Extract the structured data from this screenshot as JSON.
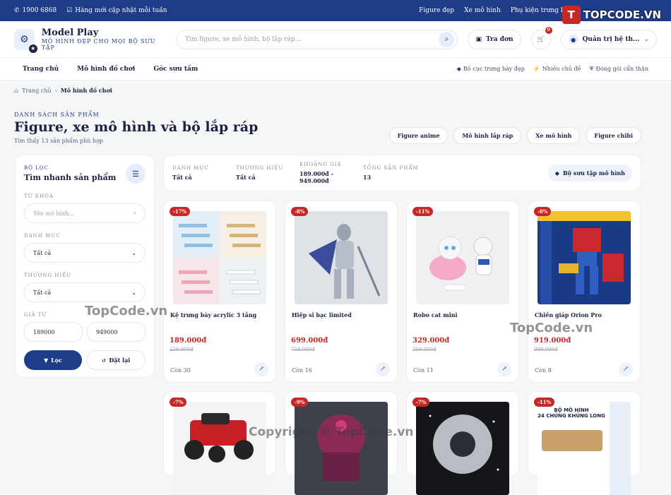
{
  "topbar": {
    "phone": "1900 6868",
    "notice": "Hàng mới cập nhật mỗi tuần",
    "links": [
      "Figure đẹp",
      "Xe mô hình",
      "Phụ kiện trưng bày"
    ]
  },
  "badge": {
    "mark": "T",
    "text": "TOPCODE.VN"
  },
  "brand": {
    "name": "Model Play",
    "tagline": "MÔ HÌNH ĐẸP CHO MỌI BỘ SƯU TẬP"
  },
  "search": {
    "placeholder": "Tìm figure, xe mô hình, bộ lắp ráp..."
  },
  "header": {
    "orders_label": "Tra đơn",
    "cart_count": "0",
    "user_label": "Quản trị hệ th..."
  },
  "nav": {
    "menu": [
      "Trang chủ",
      "Mô hình đồ chơi",
      "Góc sưu tầm"
    ],
    "features": [
      "Bố cục trưng bày đẹp",
      "Nhiều chủ đề",
      "Đóng gói cẩn thận"
    ]
  },
  "breadcrumb": {
    "home": "Trang chủ",
    "current": "Mô hình đồ chơi"
  },
  "page": {
    "eyebrow": "DANH SÁCH SẢN PHẨM",
    "title": "Figure, xe mô hình và bộ lắp ráp",
    "count": "Tìm thấy 13 sản phẩm phù hợp",
    "chips": [
      "Figure anime",
      "Mô hình lắp ráp",
      "Xe mô hình",
      "Figure chibi"
    ]
  },
  "filter": {
    "eyebrow": "BỘ LỌC",
    "title": "Tìm nhanh sản phẩm",
    "keyword_label": "TỪ KHÓA",
    "keyword_placeholder": "Tên mô hình...",
    "category_label": "DANH MỤC",
    "category_value": "Tất cả",
    "brand_label": "THƯƠNG HIỆU",
    "brand_value": "Tất cả",
    "price_from_label": "GIÁ TỪ",
    "price_from": "189000",
    "price_to": "949000",
    "apply_label": "Lọc",
    "reset_label": "Đặt lại"
  },
  "summary": {
    "items": [
      {
        "key": "DANH MỤC",
        "value": "Tất cả"
      },
      {
        "key": "THƯƠNG HIỆU",
        "value": "Tất cả"
      },
      {
        "key": "KHOẢNG GIÁ",
        "value": "189.000đ - 949.000đ"
      },
      {
        "key": "TỔNG SẢN PHẨM",
        "value": "13"
      }
    ],
    "collection_label": "Bộ sưu tập mô hình"
  },
  "products": [
    {
      "discount": "-17%",
      "name": "Kệ trưng bày acrylic 3 tầng",
      "price": "189.000đ",
      "old": "229.000đ",
      "stock": "Còn 30"
    },
    {
      "discount": "-8%",
      "name": "Hiệp sĩ bạc limited",
      "price": "699.000đ",
      "old": "759.000đ",
      "stock": "Còn 16"
    },
    {
      "discount": "-11%",
      "name": "Robo cat mini",
      "price": "329.000đ",
      "old": "369.000đ",
      "stock": "Còn 11"
    },
    {
      "discount": "-8%",
      "name": "Chiến giáp Orion Pro",
      "price": "919.000đ",
      "old": "999.000đ",
      "stock": "Còn 8"
    },
    {
      "discount": "-7%"
    },
    {
      "discount": "-9%"
    },
    {
      "discount": "-7%"
    },
    {
      "discount": "-11%",
      "img_title": "BỘ MÔ HÌNH",
      "img_sub": "24 CHỦNG KHỦNG LONG"
    }
  ],
  "watermarks": [
    "TopCode.vn",
    "TopCode.vn",
    "Copyright © TopCode.vn"
  ]
}
